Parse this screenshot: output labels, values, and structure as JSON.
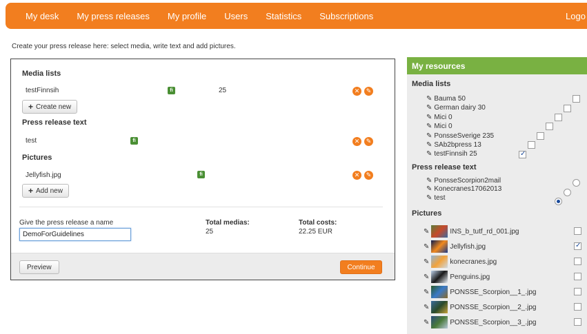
{
  "nav": {
    "items": [
      "My desk",
      "My press releases",
      "My profile",
      "Users",
      "Statistics",
      "Subscriptions"
    ],
    "logout": "Logo"
  },
  "intro": "Create your press release here: select media, write text and add pictures.",
  "editor": {
    "media_lists_title": "Media lists",
    "media_row": {
      "name": "testFinnsih",
      "lang": "fi",
      "count": "25"
    },
    "create_new": "Create new",
    "text_title": "Press release text",
    "text_row": {
      "name": "test",
      "lang": "fi"
    },
    "pictures_title": "Pictures",
    "picture_row": {
      "name": "Jellyfish.jpg",
      "lang": "fi"
    },
    "add_new": "Add new",
    "name_label": "Give the press release a name",
    "name_value": "DemoForGuidelines",
    "total_medias_label": "Total medias:",
    "total_medias_value": "25",
    "total_costs_label": "Total costs:",
    "total_costs_value": "22.25 EUR",
    "preview": "Preview",
    "continue": "Continue"
  },
  "resources": {
    "title": "My resources",
    "media_lists_title": "Media lists",
    "media_lists": [
      {
        "label": "Bauma 50",
        "checked": false
      },
      {
        "label": "German dairy 30",
        "checked": false
      },
      {
        "label": "Mici 0",
        "checked": false
      },
      {
        "label": "Mici 0",
        "checked": false
      },
      {
        "label": "PonsseSverige 235",
        "checked": false
      },
      {
        "label": "SAb2bpress 13",
        "checked": false
      },
      {
        "label": "testFinnsih 25",
        "checked": true
      }
    ],
    "text_title": "Press release text",
    "texts": [
      {
        "label": "PonsseScorpion2mail",
        "checked": false
      },
      {
        "label": "Konecranes17062013",
        "checked": false
      },
      {
        "label": "test",
        "checked": true
      }
    ],
    "pictures_title": "Pictures",
    "pictures": [
      {
        "label": "INS_b_tutf_rd_001.jpg",
        "checked": false
      },
      {
        "label": "Jellyfish.jpg",
        "checked": true
      },
      {
        "label": "konecranes.jpg",
        "checked": false
      },
      {
        "label": "Penguins.jpg",
        "checked": false
      },
      {
        "label": "PONSSE_Scorpion__1_.jpg",
        "checked": false
      },
      {
        "label": "PONSSE_Scorpion__2_.jpg",
        "checked": false
      },
      {
        "label": "PONSSE_Scorpion__3_.jpg",
        "checked": false
      }
    ]
  },
  "colors": {
    "accent": "#f27e1f",
    "green": "#79b142",
    "badge": "#4a8f34"
  },
  "icons": {
    "pencil": "pencil-icon",
    "remove": "remove-icon",
    "edit": "edit-icon",
    "plus": "plus-icon"
  }
}
